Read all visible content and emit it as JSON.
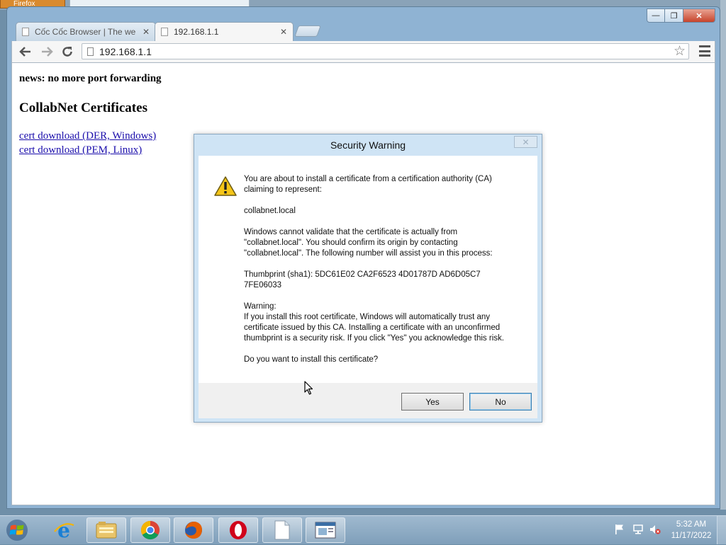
{
  "background": {
    "firefox_tab_label": "Firefox"
  },
  "browser": {
    "tabs": [
      {
        "title": "Cốc Cốc Browser | The we",
        "active": false
      },
      {
        "title": "192.168.1.1",
        "active": true
      }
    ],
    "address": "192.168.1.1",
    "window_buttons": {
      "minimize": "—",
      "maximize": "❐",
      "close": "✕"
    }
  },
  "page": {
    "news": "news: no more port forwarding",
    "heading": "CollabNet Certificates",
    "links": [
      "cert download (DER, Windows)",
      "cert download (PEM, Linux)"
    ]
  },
  "dialog": {
    "title": "Security Warning",
    "paragraphs": [
      "You are about to install a certificate from a certification authority (CA) claiming to represent:",
      "collabnet.local",
      "Windows cannot validate that the certificate is actually from \"collabnet.local\". You should confirm its origin by contacting \"collabnet.local\". The following number will assist you in this process:",
      "Thumbprint (sha1): 5DC61E02 CA2F6523 4D01787D AD6D05C7 7FE06033",
      "Warning:",
      "If you install this root certificate, Windows will automatically trust any certificate issued by this CA. Installing a certificate with an unconfirmed thumbprint is a security risk. If you click \"Yes\" you acknowledge this risk.",
      "Do you want to install this certificate?"
    ],
    "yes_label": "Yes",
    "no_label": "No"
  },
  "taskbar": {
    "time": "5:32 AM",
    "date": "11/17/2022",
    "apps": [
      "internet-explorer",
      "file-explorer",
      "chrome",
      "firefox",
      "opera",
      "notepad",
      "window"
    ]
  },
  "colors": {
    "link": "#1a0dab",
    "dialog_frame": "#cfe4f5",
    "taskbar": "#8fabc4"
  }
}
